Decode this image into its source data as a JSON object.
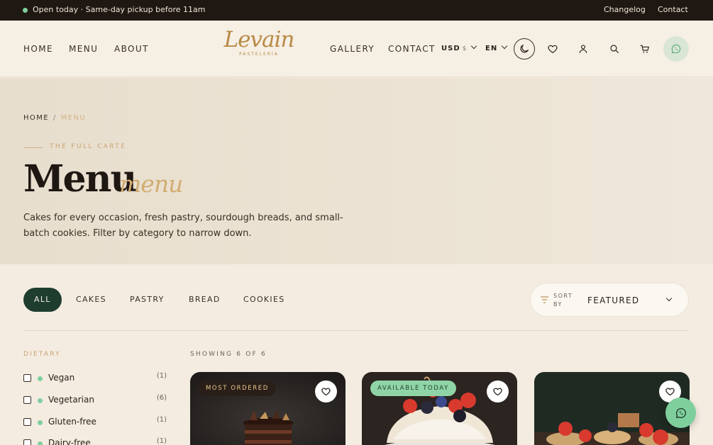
{
  "topbar": {
    "announcement": "Open today · Same-day pickup before 11am",
    "links": [
      "Changelog",
      "Contact"
    ]
  },
  "header": {
    "nav_left": [
      "HOME",
      "MENU",
      "ABOUT"
    ],
    "nav_right": [
      "GALLERY",
      "CONTACT"
    ],
    "logo": {
      "word": "Levain",
      "sub": "PASTELERÍA"
    },
    "currency": {
      "code": "USD",
      "symbol": "$"
    },
    "language": "EN",
    "icons": [
      "moon-icon",
      "heart-icon",
      "user-icon",
      "search-icon",
      "cart-icon",
      "whatsapp-icon"
    ]
  },
  "hero": {
    "breadcrumb": [
      "HOME",
      "MENU"
    ],
    "eyebrow": "THE FULL CARTE",
    "title": "Menu",
    "title_script": "menu",
    "description": "Cakes for every occasion, fresh pastry, sourdough breads, and small-batch cookies. Filter by category to narrow down."
  },
  "filters": {
    "categories": [
      "ALL",
      "CAKES",
      "PASTRY",
      "BREAD",
      "COOKIES"
    ],
    "active_category": "ALL",
    "sort": {
      "label": "SORT BY",
      "value": "FEATURED"
    }
  },
  "sidebar": {
    "title": "DIETARY",
    "options": [
      {
        "label": "Vegan",
        "count": "(1)"
      },
      {
        "label": "Vegetarian",
        "count": "(6)"
      },
      {
        "label": "Gluten-free",
        "count": "(1)"
      },
      {
        "label": "Dairy-free",
        "count": "(1)"
      }
    ]
  },
  "results": {
    "showing": "SHOWING 6 OF 6",
    "cards": [
      {
        "badge": "MOST ORDERED"
      },
      {
        "badge": "AVAILABLE TODAY"
      },
      {
        "badge": ""
      }
    ]
  },
  "colors": {
    "accent_gold": "#c9a46f",
    "dark_green": "#1e3d2e",
    "mint": "#7fcf9c",
    "topbar_bg": "#1f1712"
  }
}
